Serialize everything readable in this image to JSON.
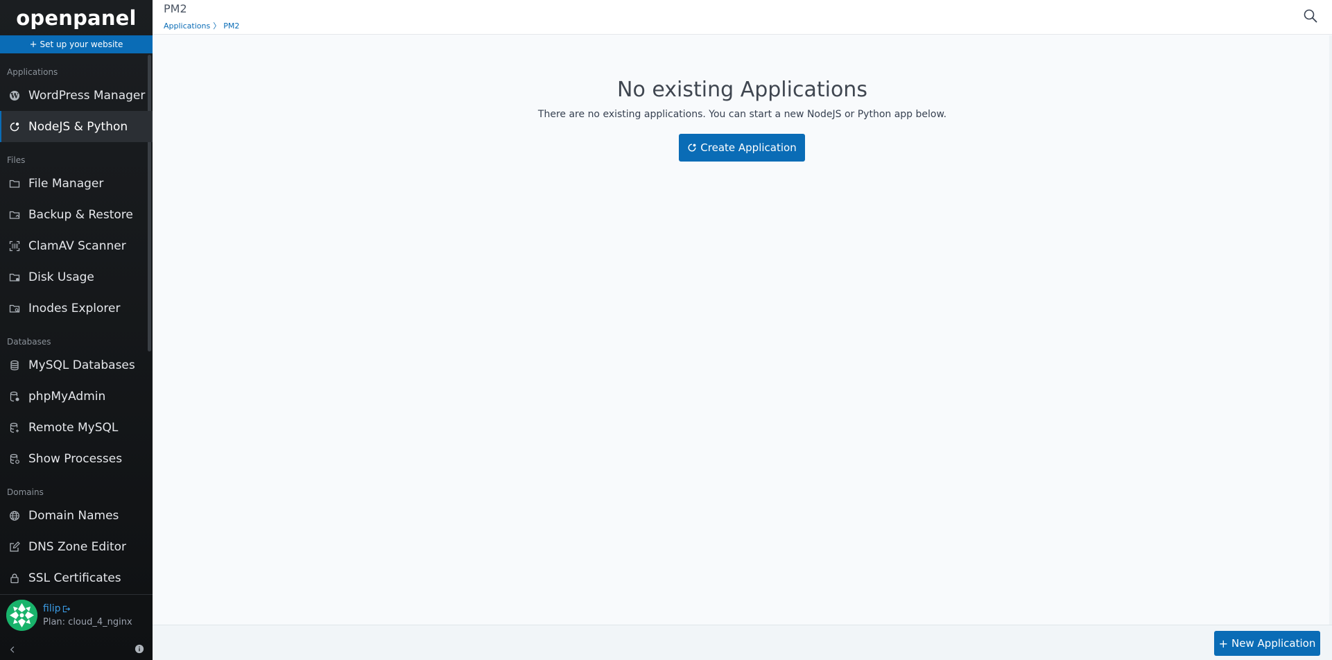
{
  "brand": {
    "logo_text": "openpanel"
  },
  "setup": {
    "label": "Set up your website"
  },
  "sidebar": {
    "sections": [
      {
        "label": "Applications",
        "items": [
          {
            "label": "WordPress Manager",
            "icon": "wordpress-icon"
          },
          {
            "label": "NodeJS & Python",
            "icon": "nodejs-icon",
            "active": true
          }
        ]
      },
      {
        "label": "Files",
        "items": [
          {
            "label": "File Manager",
            "icon": "folder-icon"
          },
          {
            "label": "Backup & Restore",
            "icon": "folder-backup-icon"
          },
          {
            "label": "ClamAV Scanner",
            "icon": "scanner-icon"
          },
          {
            "label": "Disk Usage",
            "icon": "folder-usage-icon"
          },
          {
            "label": "Inodes Explorer",
            "icon": "folder-search-icon"
          }
        ]
      },
      {
        "label": "Databases",
        "items": [
          {
            "label": "MySQL Databases",
            "icon": "database-icon"
          },
          {
            "label": "phpMyAdmin",
            "icon": "database-user-icon"
          },
          {
            "label": "Remote MySQL",
            "icon": "database-remote-icon"
          },
          {
            "label": "Show Processes",
            "icon": "database-process-icon"
          }
        ]
      },
      {
        "label": "Domains",
        "items": [
          {
            "label": "Domain Names",
            "icon": "globe-icon"
          },
          {
            "label": "DNS Zone Editor",
            "icon": "edit-icon"
          },
          {
            "label": "SSL Certificates",
            "icon": "lock-icon"
          }
        ]
      }
    ]
  },
  "user": {
    "name": "filip",
    "plan": "Plan: cloud_4_nginx"
  },
  "header": {
    "title": "PM2",
    "breadcrumb": {
      "parent": "Applications",
      "separator": "〉",
      "current": "PM2"
    }
  },
  "main": {
    "empty_title": "No existing Applications",
    "empty_description": "There are no existing applications. You can start a new NodeJS or Python app below.",
    "create_button": "Create Application"
  },
  "footer": {
    "new_button": "New Application"
  },
  "colors": {
    "accent": "#0a6cb6",
    "sidebar_bg": "#1b1e21",
    "avatar": "#19b36b"
  }
}
